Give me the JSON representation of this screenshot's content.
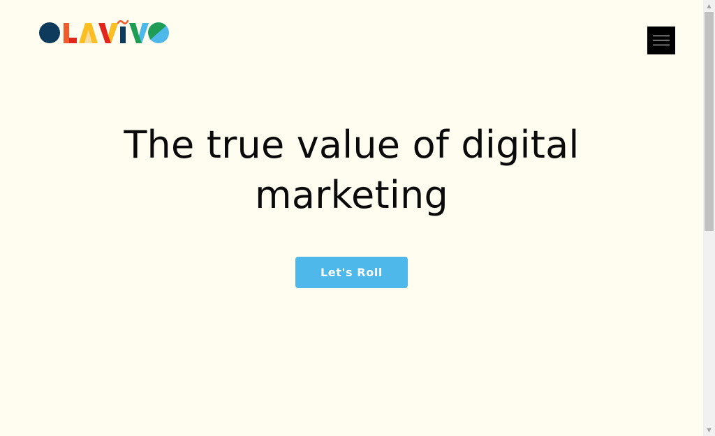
{
  "header": {
    "logo_text": "OLAVIVO",
    "logo_colors": [
      "#0e3b5c",
      "#f15a29",
      "#fbbf24",
      "#e1261c",
      "#1f9d55",
      "#4fb8ea"
    ],
    "menu_icon": "hamburger-icon"
  },
  "hero": {
    "title": "The true value of digital marketing",
    "cta_label": "Let's Roll",
    "cta_color": "#4fb8ea"
  },
  "scrollbar": {
    "up_icon": "▲",
    "down_icon": "▼"
  }
}
